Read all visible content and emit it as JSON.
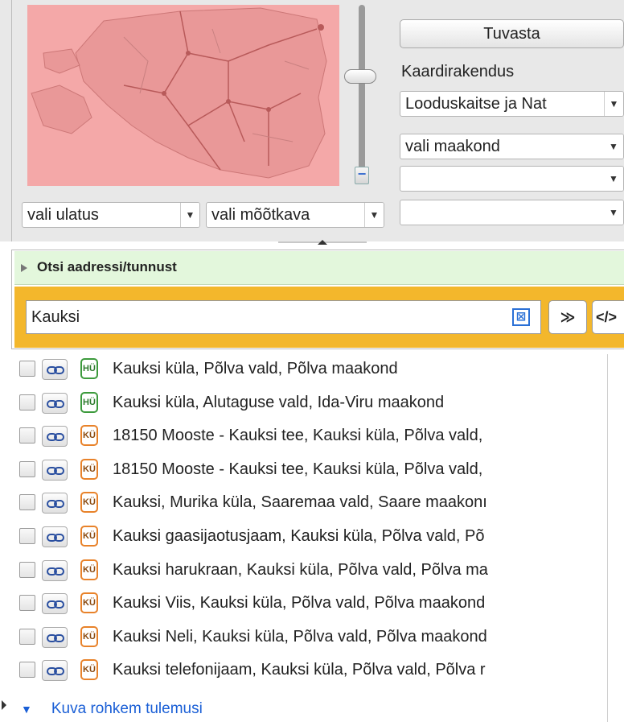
{
  "top": {
    "identify_button": "Tuvasta",
    "map_app_label": "Kaardirakendus",
    "map_app_select": "Looduskaitse ja Nat",
    "county_select": "vali maakond",
    "extra_select_1": "",
    "extra_select_2": "",
    "extent_select": "vali ulatus",
    "scale_select": "vali mõõtkava"
  },
  "search": {
    "header": "Otsi aadressi/tunnust",
    "query": "Kauksi",
    "clear_symbol": "⊠",
    "expand_symbol": "≫",
    "code_symbol": "</>"
  },
  "results": [
    {
      "badge": "HÜ",
      "badge_color": "#3c9a3c",
      "text": "Kauksi küla, Põlva vald, Põlva maakond"
    },
    {
      "badge": "HÜ",
      "badge_color": "#3c9a3c",
      "text": "Kauksi küla, Alutaguse vald, Ida-Viru maakond"
    },
    {
      "badge": "KÜ",
      "badge_color": "#e8822a",
      "text": "18150 Mooste - Kauksi tee, Kauksi küla, Põlva vald,"
    },
    {
      "badge": "KÜ",
      "badge_color": "#e8822a",
      "text": "18150 Mooste - Kauksi tee, Kauksi küla, Põlva vald,"
    },
    {
      "badge": "KÜ",
      "badge_color": "#e8822a",
      "text": "Kauksi, Murika küla, Saaremaa vald, Saare maakonı"
    },
    {
      "badge": "KÜ",
      "badge_color": "#e8822a",
      "text": "Kauksi gaasijaotusjaam, Kauksi küla, Põlva vald, Põ"
    },
    {
      "badge": "KÜ",
      "badge_color": "#e8822a",
      "text": "Kauksi harukraan, Kauksi küla, Põlva vald, Põlva ma"
    },
    {
      "badge": "KÜ",
      "badge_color": "#e8822a",
      "text": "Kauksi Viis, Kauksi küla, Põlva vald, Põlva maakond"
    },
    {
      "badge": "KÜ",
      "badge_color": "#e8822a",
      "text": "Kauksi Neli, Kauksi küla, Põlva vald, Põlva maakond"
    },
    {
      "badge": "KÜ",
      "badge_color": "#e8822a",
      "text": "Kauksi telefonijaam, Kauksi küla, Põlva vald, Põlva r"
    }
  ],
  "more_results": "Kuva rohkem tulemusi",
  "colors": {
    "map_fill": "#f4a8a8",
    "search_header_bg": "#e3f7dc",
    "search_bar_bg": "#f3b72c",
    "link_color": "#1a5fd6"
  }
}
